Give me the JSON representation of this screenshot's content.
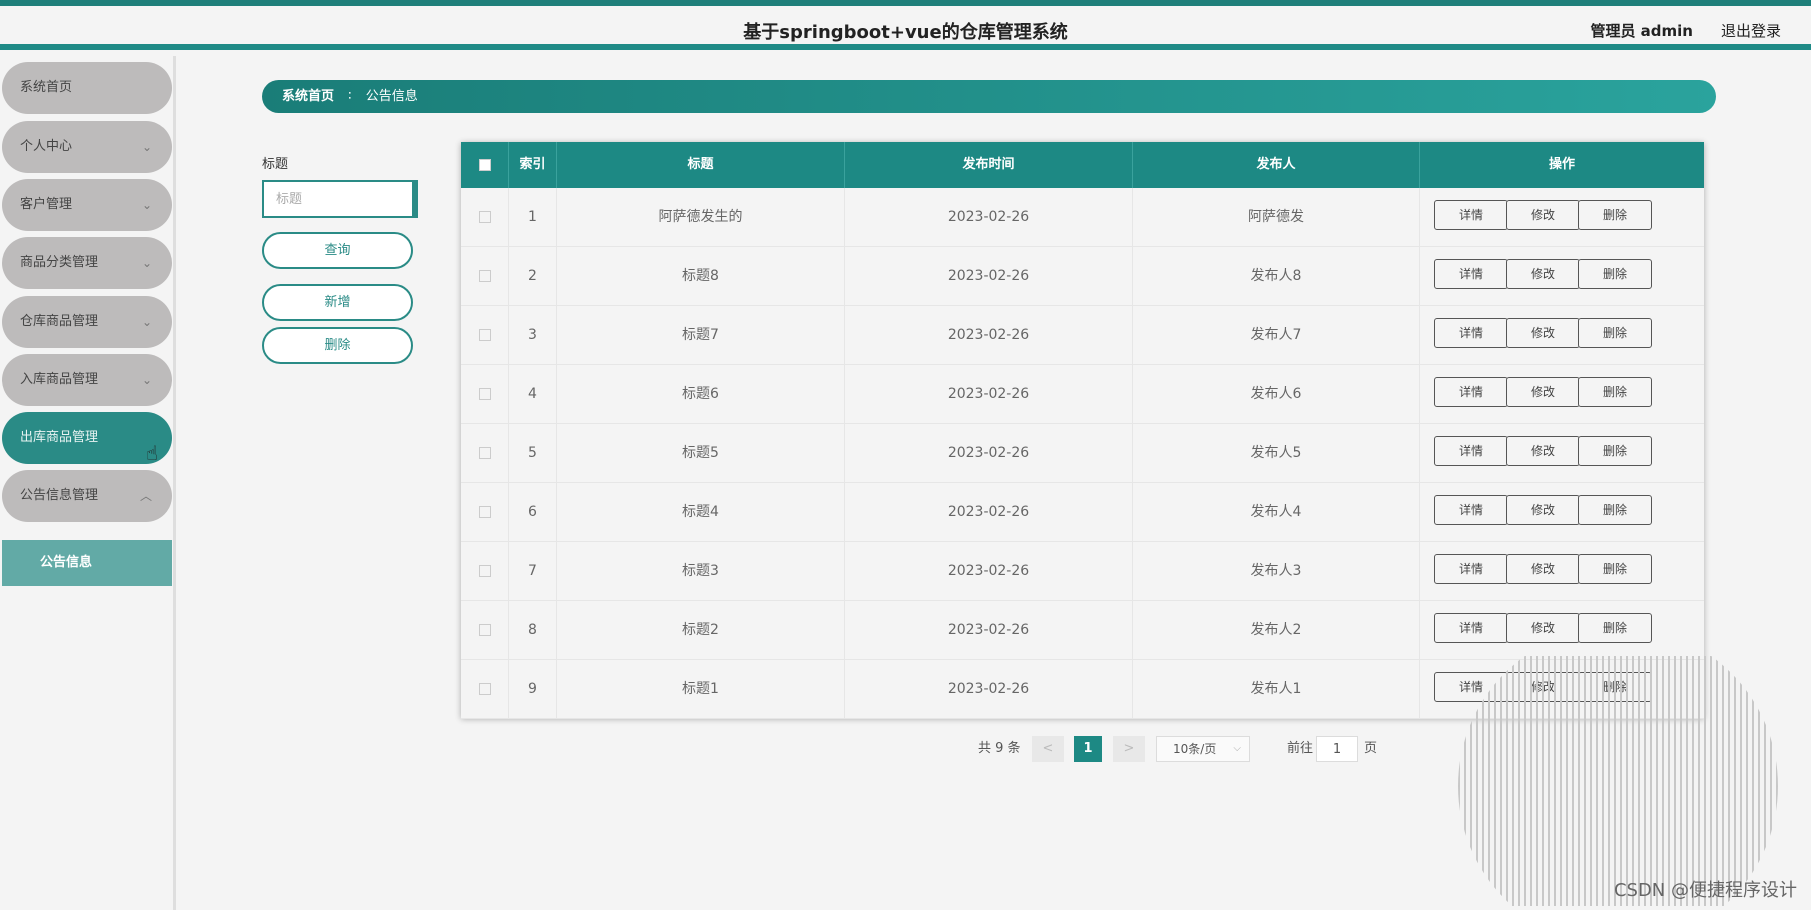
{
  "header": {
    "title": "基于springboot+vue的仓库管理系统",
    "user": "管理员 admin",
    "logout": "退出登录"
  },
  "sidebar": {
    "items": [
      {
        "label": "系统首页",
        "has_arrow": false
      },
      {
        "label": "个人中心",
        "has_arrow": true
      },
      {
        "label": "客户管理",
        "has_arrow": true
      },
      {
        "label": "商品分类管理",
        "has_arrow": true
      },
      {
        "label": "仓库商品管理",
        "has_arrow": true
      },
      {
        "label": "入库商品管理",
        "has_arrow": true
      },
      {
        "label": "出库商品管理",
        "has_arrow": false,
        "active": true
      },
      {
        "label": "公告信息管理",
        "has_arrow": true,
        "expanded": true
      }
    ],
    "sub_item": "公告信息",
    "chevron_down": "⌄",
    "chevron_up": "︿"
  },
  "breadcrumb": {
    "home": "系统首页",
    "separator": "∶",
    "current": "公告信息"
  },
  "search": {
    "label": "标题",
    "placeholder": "标题",
    "query_button": "查询",
    "add_button": "新增",
    "delete_button": "删除"
  },
  "table": {
    "columns": [
      "索引",
      "标题",
      "发布时间",
      "发布人",
      "操作"
    ],
    "rows": [
      {
        "index": "1",
        "title": "阿萨德发生的",
        "date": "2023-02-26",
        "publisher": "阿萨德发"
      },
      {
        "index": "2",
        "title": "标题8",
        "date": "2023-02-26",
        "publisher": "发布人8"
      },
      {
        "index": "3",
        "title": "标题7",
        "date": "2023-02-26",
        "publisher": "发布人7"
      },
      {
        "index": "4",
        "title": "标题6",
        "date": "2023-02-26",
        "publisher": "发布人6"
      },
      {
        "index": "5",
        "title": "标题5",
        "date": "2023-02-26",
        "publisher": "发布人5"
      },
      {
        "index": "6",
        "title": "标题4",
        "date": "2023-02-26",
        "publisher": "发布人4"
      },
      {
        "index": "7",
        "title": "标题3",
        "date": "2023-02-26",
        "publisher": "发布人3"
      },
      {
        "index": "8",
        "title": "标题2",
        "date": "2023-02-26",
        "publisher": "发布人2"
      },
      {
        "index": "9",
        "title": "标题1",
        "date": "2023-02-26",
        "publisher": "发布人1"
      }
    ],
    "actions": {
      "detail": "详情",
      "edit": "修改",
      "delete": "删除"
    }
  },
  "pagination": {
    "total": "共 9 条",
    "prev": "<",
    "current_page": "1",
    "next": ">",
    "page_size": "10条/页",
    "goto_label": "前往",
    "goto_value": "1",
    "page_suffix": "页"
  },
  "watermark": "CSDN @便捷程序设计",
  "colors": {
    "accent": "#1d8984",
    "menu_bg": "#bdbbbb",
    "submenu_bg": "#62aaa6"
  },
  "icons": {
    "cursor": "hand-pointer-icon"
  }
}
